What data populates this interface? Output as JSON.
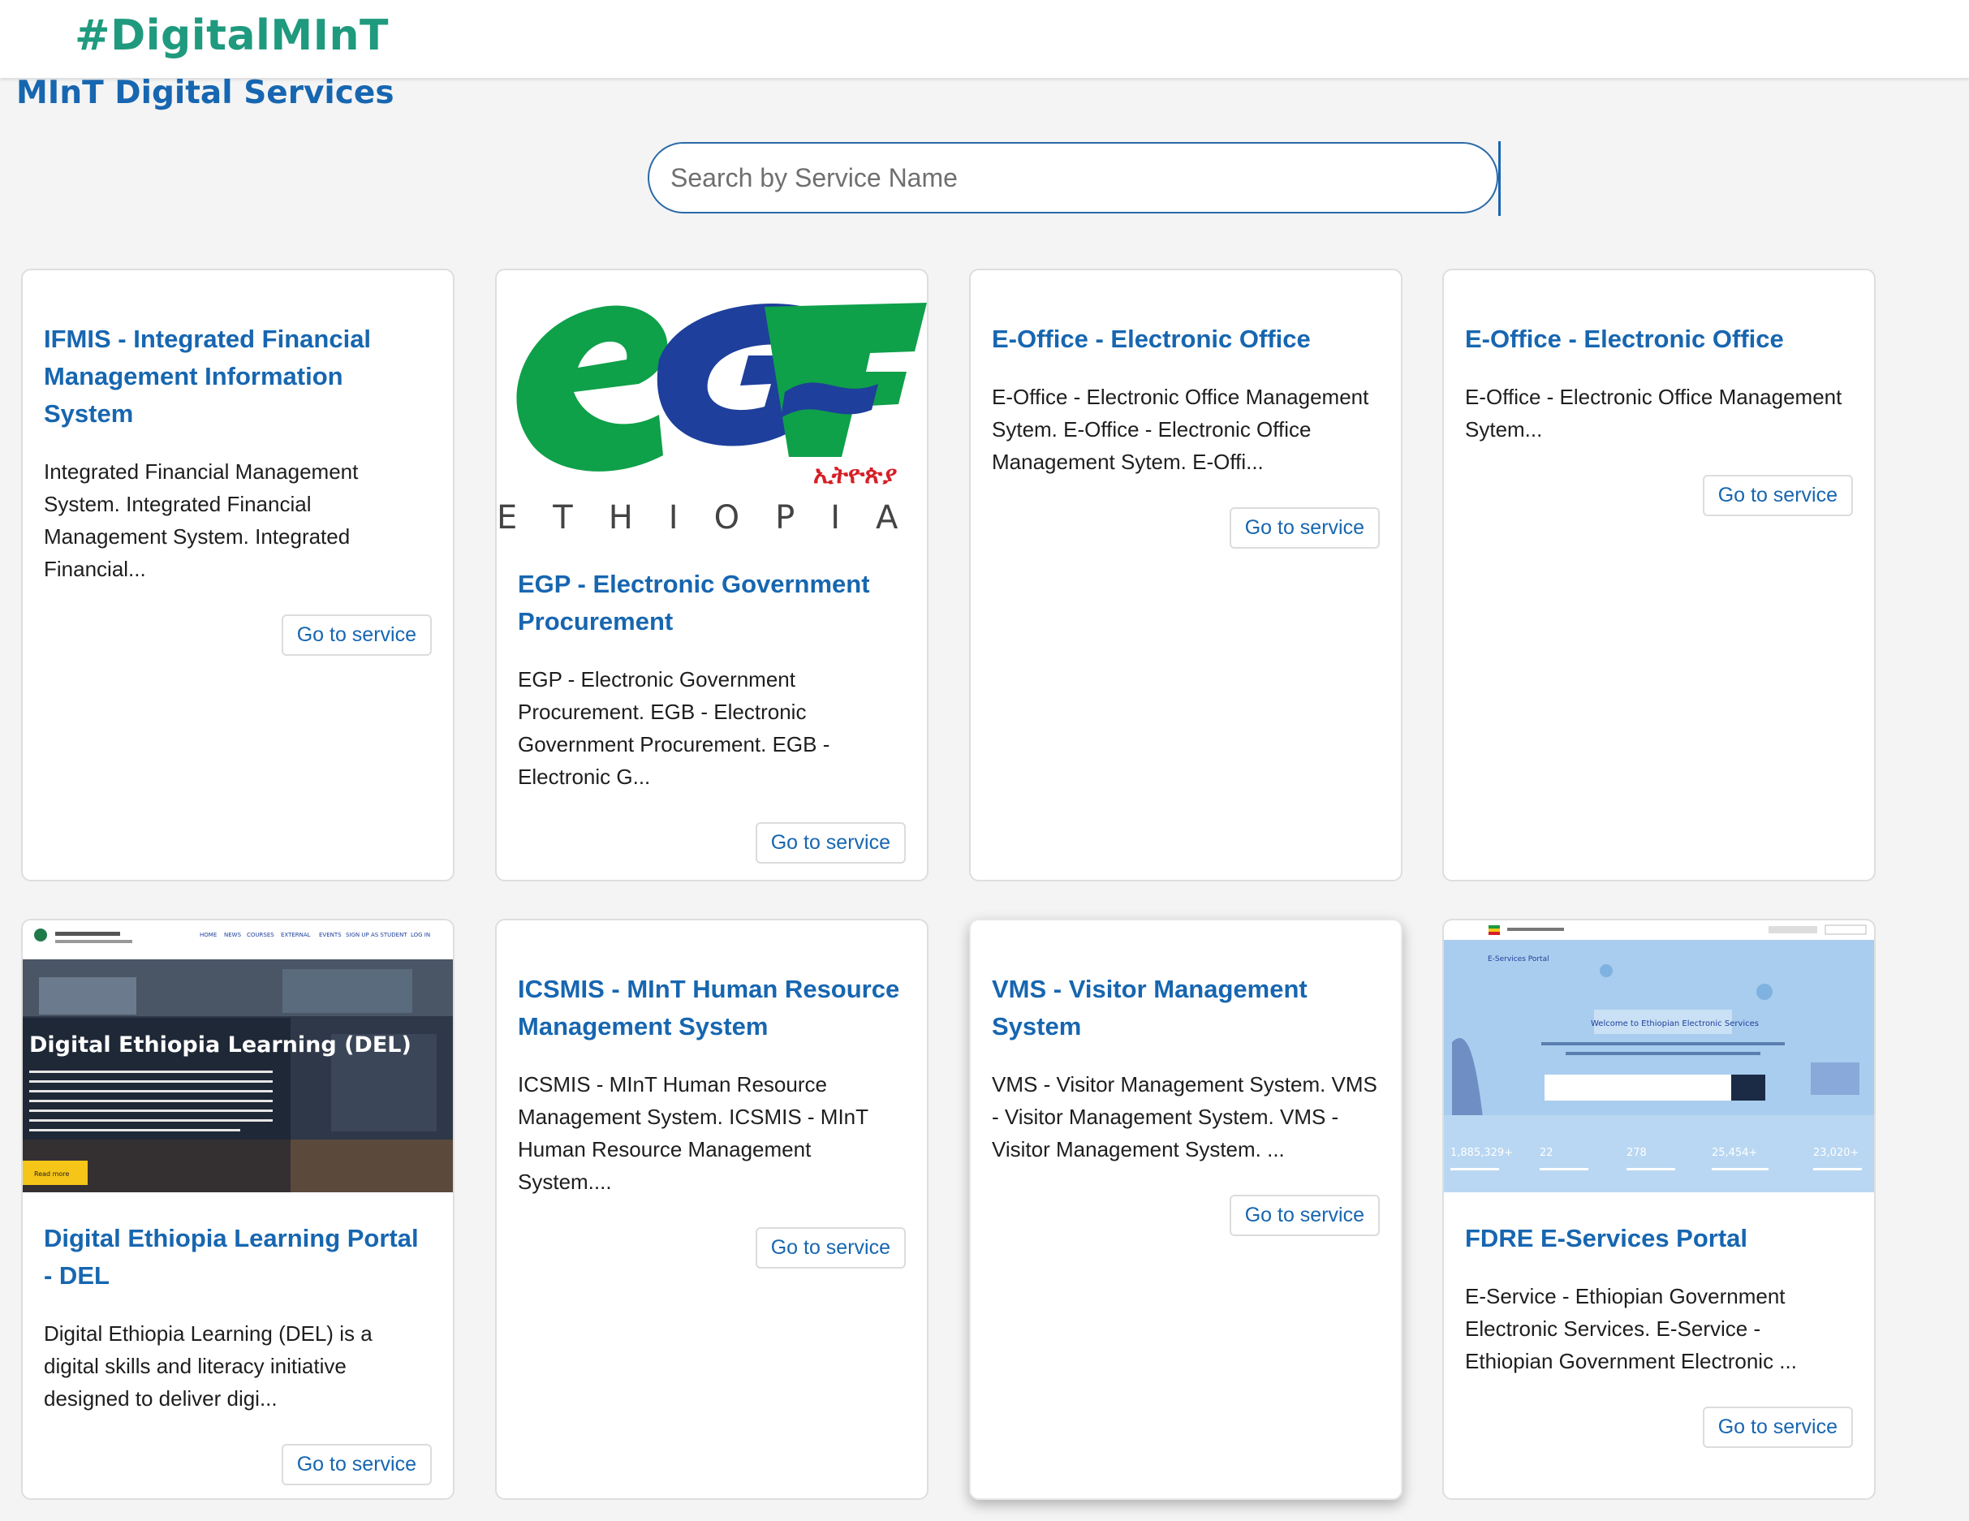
{
  "header": {
    "brand": "#DigitalMInT"
  },
  "page": {
    "title": "MInT Digital Services"
  },
  "search": {
    "placeholder": "Search by Service Name",
    "value": ""
  },
  "cards": [
    {
      "title": "IFMIS - Integrated Financial Management Information System",
      "description": "Integrated Financial Management System. Integrated Financial Management System. Integrated Financial...",
      "button": "Go to service"
    },
    {
      "title": "EGP - Electronic Government Procurement",
      "description": "EGP - Electronic Government Procurement. EGB - Electronic Government Procurement. EGB - Electronic G...",
      "button": "Go to service",
      "image": {
        "logo_text": "eGP",
        "amharic": "ኢትዮጵያ",
        "subtitle": "ETHIOPIA"
      }
    },
    {
      "title": "E-Office - Electronic Office",
      "description": "E-Office - Electronic Office Management Sytem. E-Office - Electronic Office Management Sytem. E-Offi...",
      "button": "Go to service"
    },
    {
      "title": "E-Office - Electronic Office",
      "description": "E-Office - Electronic Office Management Sytem...",
      "button": "Go to service"
    },
    {
      "title": "Digital Ethiopia Learning Portal - DEL",
      "description": "Digital Ethiopia Learning (DEL) is a digital skills and literacy initiative designed to deliver digi...",
      "button": "Go to service",
      "image": {
        "headline": "Digital Ethiopia Learning (DEL)",
        "nav": [
          "HOME",
          "NEWS",
          "COURSES",
          "EXTERNAL",
          "EVENTS",
          "SIGN UP AS STUDENT",
          "LOG IN"
        ],
        "cta": "Read more"
      }
    },
    {
      "title": "ICSMIS - MInT Human Resource Management System",
      "description": "ICSMIS - MInT Human Resource Management System. ICSMIS - MInT Human Resource Management System....",
      "button": "Go to service"
    },
    {
      "title": "VMS - Visitor Management System",
      "description": "VMS - Visitor Management System. VMS - Visitor Management System. VMS - Visitor Management System. ...",
      "button": "Go to service"
    },
    {
      "title": "FDRE E-Services Portal",
      "description": "E-Service - Ethiopian Government Electronic Services. E-Service - Ethiopian Government Electronic ...",
      "button": "Go to service",
      "image": {
        "portal_label": "E-Services Portal",
        "welcome": "Welcome to Ethiopian Electronic Services",
        "stats": [
          "1,885,329+",
          "22",
          "278",
          "25,454+",
          "23,020+"
        ]
      }
    }
  ],
  "colors": {
    "brand": "#1f9a7e",
    "primary": "#1766b0",
    "egp_green": "#0fa04a",
    "egp_blue": "#1e3f9b",
    "egp_red": "#d61f26",
    "cta_yellow": "#f5c518"
  }
}
